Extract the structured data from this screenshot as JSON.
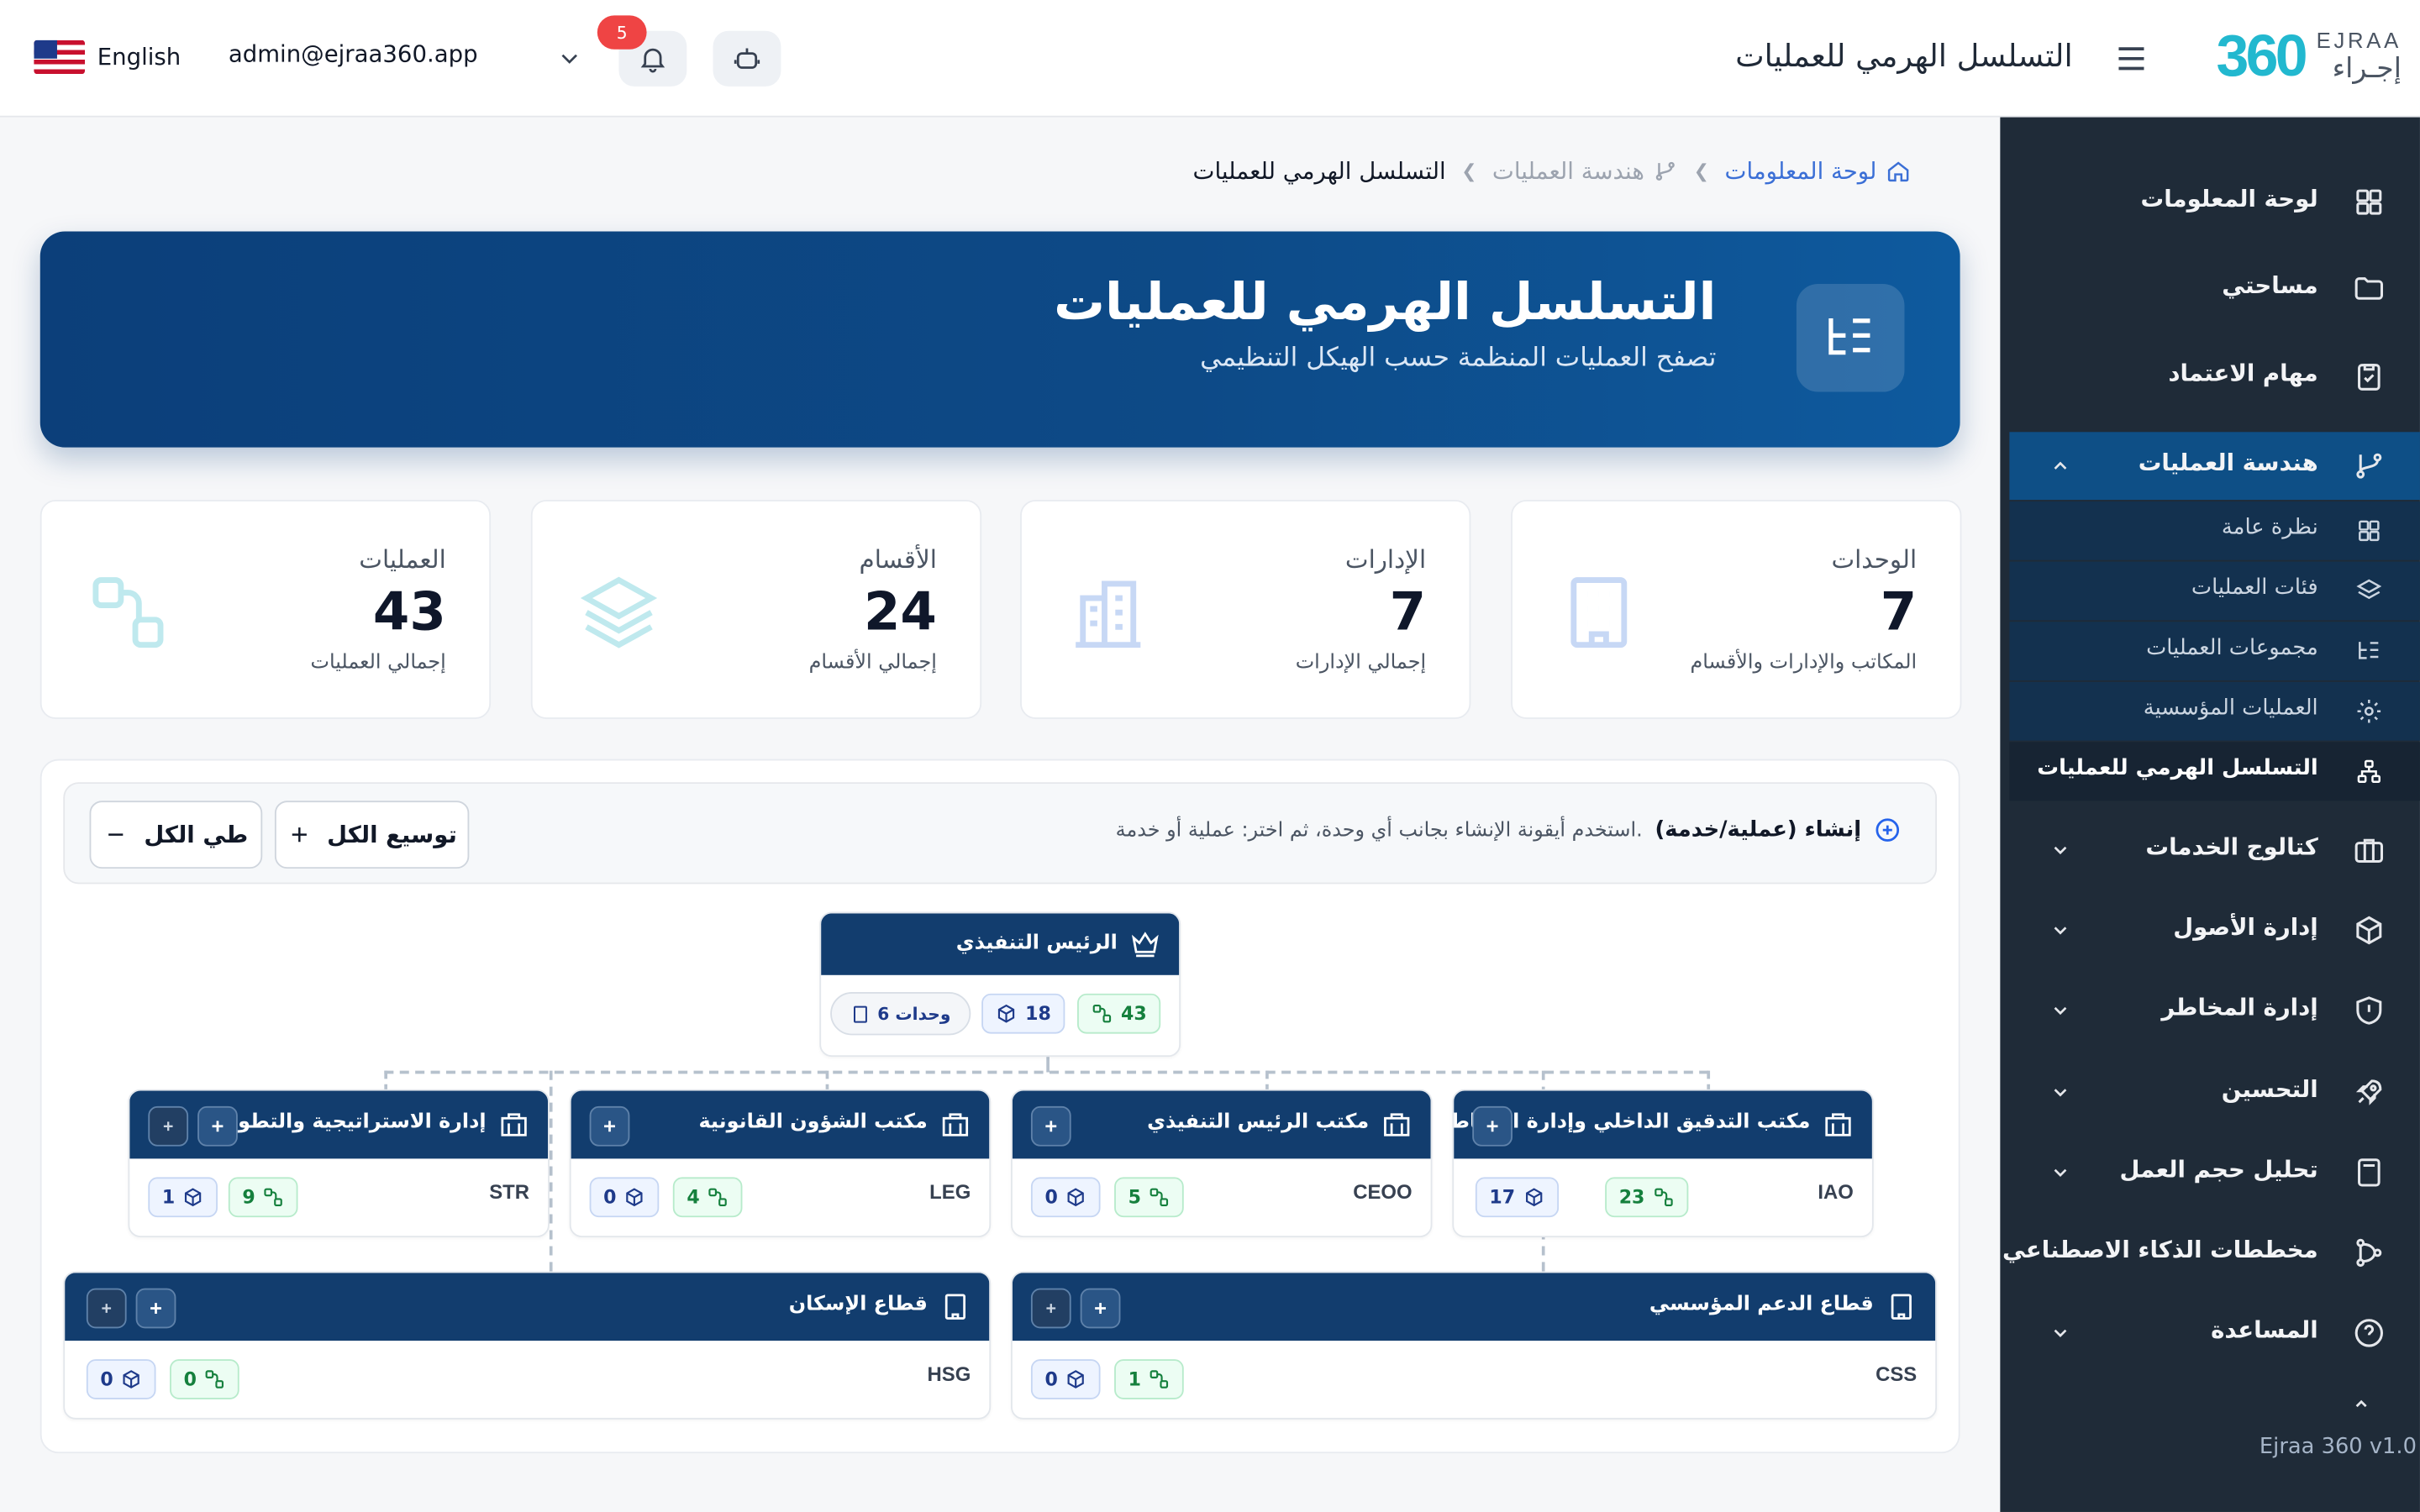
{
  "header": {
    "language": "English",
    "user_email": "admin@ejraa360.app",
    "notification_count": "5",
    "page_title": "التسلسل الهرمي للعمليات",
    "logo_number": "360",
    "logo_en": "EJRAA",
    "logo_ar": "إجـراء"
  },
  "sidebar": {
    "items": [
      {
        "label": "لوحة المعلومات",
        "icon": "dashboard-icon"
      },
      {
        "label": "مساحتي",
        "icon": "folder-icon"
      },
      {
        "label": "مهام الاعتماد",
        "icon": "clipboard-check-icon"
      },
      {
        "label": "هندسة العمليات",
        "icon": "branch-icon",
        "expanded": true
      },
      {
        "label": "كتالوج الخدمات",
        "icon": "briefcase-icon"
      },
      {
        "label": "إدارة الأصول",
        "icon": "cube-icon"
      },
      {
        "label": "إدارة المخاطر",
        "icon": "shield-icon"
      },
      {
        "label": "التحسين",
        "icon": "rocket-icon"
      },
      {
        "label": "تحليل حجم العمل",
        "icon": "calculator-icon"
      },
      {
        "label": "مخططات الذكاء الاصطناعي",
        "icon": "ai-flow-icon"
      },
      {
        "label": "المساعدة",
        "icon": "help-icon"
      }
    ],
    "subitems": [
      {
        "label": "نظرة عامة",
        "icon": "grid-icon"
      },
      {
        "label": "فئات العمليات",
        "icon": "layers-icon"
      },
      {
        "label": "مجموعات العمليات",
        "icon": "tree-list-icon"
      },
      {
        "label": "العمليات المؤسسية",
        "icon": "gear-icon"
      },
      {
        "label": "التسلسل الهرمي للعمليات",
        "icon": "hierarchy-icon",
        "active": true
      }
    ],
    "version": "Ejraa 360 v1.0"
  },
  "breadcrumb": {
    "home": "لوحة المعلومات",
    "parent": "هندسة العمليات",
    "current": "التسلسل الهرمي للعمليات"
  },
  "hero": {
    "title": "التسلسل الهرمي للعمليات",
    "subtitle": "تصفح العمليات المنظمة حسب الهيكل التنظيمي"
  },
  "stats": [
    {
      "title": "الوحدات",
      "value": "7",
      "subtitle": "المكاتب والإدارات والأقسام",
      "icon": "building-icon"
    },
    {
      "title": "الإدارات",
      "value": "7",
      "subtitle": "إجمالي الإدارات",
      "icon": "office-building-icon"
    },
    {
      "title": "الأقسام",
      "value": "24",
      "subtitle": "إجمالي الأقسام",
      "icon": "layers-icon"
    },
    {
      "title": "العمليات",
      "value": "43",
      "subtitle": "إجمالي العمليات",
      "icon": "process-icon"
    }
  ],
  "toolbar": {
    "create_label": "إنشاء (عملية/خدمة)",
    "create_hint": "استخدم أيقونة الإنشاء بجانب أي وحدة، ثم اختر: عملية أو خدمة.",
    "expand_all": "توسيع الكل",
    "collapse_all": "طي الكل"
  },
  "tree": {
    "root": {
      "title": "الرئيس التنفيذي",
      "processes": "43",
      "assets": "18",
      "units": "6 وحدات"
    },
    "level1": [
      {
        "title": "مكتب التدقيق الداخلي وإدارة المخاطر",
        "code": "IAO",
        "processes": "23",
        "assets": "17"
      },
      {
        "title": "مكتب الرئيس التنفيذي",
        "code": "CEOO",
        "processes": "5",
        "assets": "0"
      },
      {
        "title": "مكتب الشؤون القانونية",
        "code": "LEG",
        "processes": "4",
        "assets": "0"
      },
      {
        "title": "إدارة الاستراتيجية والتطوير",
        "code": "STR",
        "processes": "9",
        "assets": "1"
      }
    ],
    "level2": [
      {
        "title": "قطاع الدعم المؤسسي",
        "code": "CSS",
        "processes": "1",
        "assets": "0"
      },
      {
        "title": "قطاع الإسكان",
        "code": "HSG",
        "processes": "0",
        "assets": "0"
      }
    ]
  }
}
